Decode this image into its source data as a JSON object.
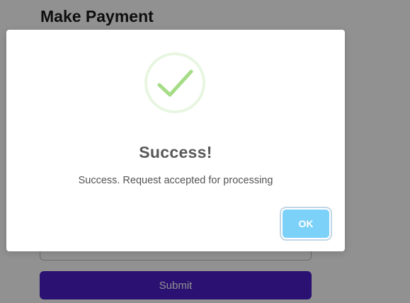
{
  "page": {
    "title": "Make Payment",
    "submit_label": "Submit"
  },
  "modal": {
    "icon": "success-checkmark-icon",
    "title": "Success!",
    "message": "Success. Request accepted for processing",
    "ok_label": "OK"
  },
  "colors": {
    "success_green": "#a5dc86",
    "ok_button": "#7cd1f9",
    "submit_button": "#4a1fc8"
  }
}
